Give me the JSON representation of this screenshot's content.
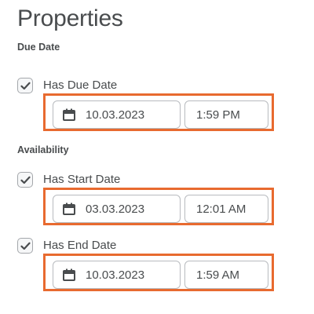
{
  "page": {
    "title": "Properties"
  },
  "due_date_section": {
    "label": "Due Date",
    "checkbox_label": "Has Due Date",
    "checked": true,
    "date": "10.03.2023",
    "time": "1:59 PM"
  },
  "availability_section": {
    "label": "Availability",
    "start": {
      "checkbox_label": "Has Start Date",
      "checked": true,
      "date": "03.03.2023",
      "time": "12:01 AM"
    },
    "end": {
      "checkbox_label": "Has End Date",
      "checked": true,
      "date": "10.03.2023",
      "time": "1:59 AM"
    }
  },
  "colors": {
    "highlight": "#e86a2f",
    "text": "#494c4e"
  },
  "icons": {
    "calendar": "calendar-icon",
    "check": "checkmark-icon"
  }
}
